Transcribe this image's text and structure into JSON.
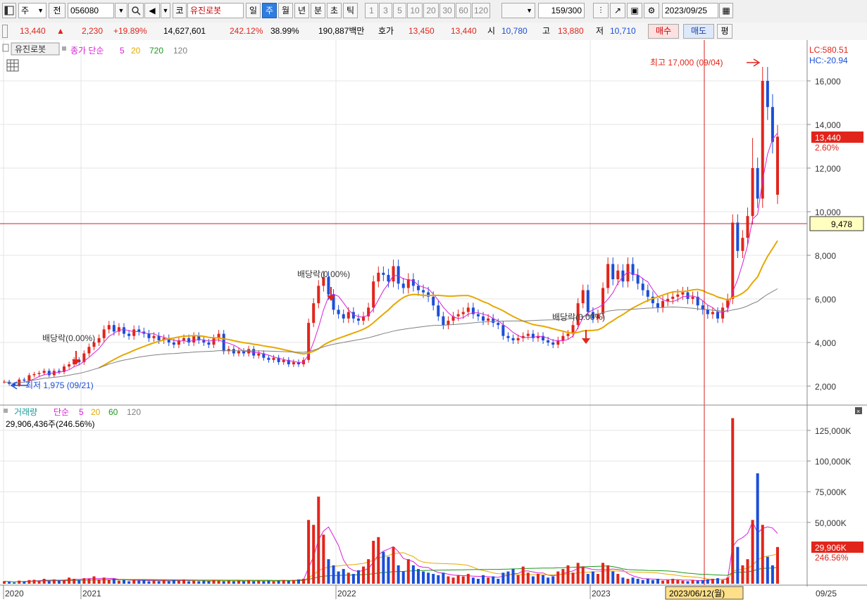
{
  "toolbar": {
    "menu_icon": "window-icon",
    "type_label": "주",
    "jeon_label": "전",
    "code": "056080",
    "market_label": "코",
    "stock_name": "유진로봇",
    "periods": [
      "일",
      "주",
      "월",
      "년",
      "분",
      "초",
      "틱"
    ],
    "active_period": "주",
    "intervals": [
      "1",
      "3",
      "5",
      "10",
      "20",
      "30",
      "60",
      "120"
    ],
    "count": "159",
    "count_total": "/300",
    "date": "2023/09/25"
  },
  "quote": {
    "price": "13,440",
    "change": "2,230",
    "change_pct": "+19.89%",
    "volume": "14,627,601",
    "vol_ratio": "242.12%",
    "turnover": "38.99%",
    "amount": "190,887백만",
    "hoga_label": "호가",
    "ask": "13,450",
    "bid": "13,440",
    "open_label": "시",
    "open": "10,780",
    "high_label": "고",
    "high": "13,880",
    "low_label": "저",
    "low": "10,710",
    "buy_label": "매수",
    "sell_label": "매도",
    "pyeong_label": "평"
  },
  "price_panel": {
    "name_tag": "유진로봇",
    "indicator": "종가 단순",
    "ma_periods": [
      "5",
      "20",
      "720",
      "120"
    ],
    "lc": "LC:580.51",
    "hc": "HC:-20.94",
    "current_price": "13,440",
    "current_pct": "2.60%",
    "crosshair_price": "9,478",
    "high_annotation": "최고 17,000 (09/04)",
    "low_annotation": "최저 1,975 (09/21)",
    "dividend_label": "배당락(0.00%)",
    "y_ticks": [
      "16,000",
      "14,000",
      "12,000",
      "10,000",
      "8,000",
      "6,000",
      "4,000",
      "2,000"
    ]
  },
  "volume_panel": {
    "title": "거래량",
    "indicator": "단순",
    "ma_periods": [
      "5",
      "20",
      "60",
      "120"
    ],
    "current": "29,906,436주(246.56%)",
    "current_tag": "29,906K",
    "current_pct": "246.56%",
    "y_ticks": [
      "125,000K",
      "100,000K",
      "75,000K",
      "50,000K"
    ]
  },
  "x_axis": {
    "labels": [
      "2020",
      "2021",
      "2022",
      "2023"
    ],
    "crosshair_date": "2023/06/12(월)",
    "right_label": "09/25"
  },
  "colors": {
    "up": "#e1251b",
    "down": "#1b4ed8",
    "ma5": "#d81fd8",
    "ma20": "#e6a800",
    "ma60": "#1a9a1a",
    "ma120": "#808080",
    "crosshair": "#d32020"
  },
  "chart_data": {
    "type": "candlestick",
    "timeframe": "weekly",
    "price_range": [
      1300,
      18000
    ],
    "volume_range": [
      0,
      140000
    ],
    "anchors": [
      {
        "date": "2020-09-21",
        "low": 1975
      },
      {
        "date": "2023-09-04",
        "high": 17000
      },
      {
        "date": "2023-09-25",
        "open": 10780,
        "high": 13880,
        "low": 10710,
        "close": 13440,
        "volume_k": 29906
      }
    ],
    "close": [
      2200,
      2100,
      2050,
      2300,
      2250,
      2500,
      2550,
      2600,
      2700,
      2500,
      2700,
      2650,
      2900,
      3000,
      3200,
      3100,
      3500,
      3800,
      4000,
      4200,
      4600,
      4800,
      4500,
      4700,
      4400,
      4300,
      4600,
      4500,
      4400,
      4200,
      4300,
      4100,
      4200,
      4000,
      3900,
      4100,
      4200,
      4000,
      4300,
      4100,
      4000,
      3900,
      4200,
      4400,
      3600,
      3700,
      3500,
      3600,
      3500,
      3700,
      3400,
      3500,
      3300,
      3200,
      3300,
      3100,
      3200,
      3000,
      3100,
      3000,
      3200,
      4900,
      5800,
      6600,
      7000,
      6200,
      5500,
      5300,
      5100,
      5400,
      5100,
      5000,
      5200,
      5600,
      6800,
      7200,
      7100,
      6800,
      7500,
      6700,
      6500,
      6900,
      6600,
      6400,
      6300,
      6100,
      5700,
      5200,
      4800,
      5000,
      5200,
      5300,
      5400,
      5600,
      5300,
      5200,
      5000,
      5100,
      4900,
      4800,
      4300,
      4200,
      4100,
      4200,
      4300,
      4400,
      4200,
      4300,
      4100,
      4000,
      3900,
      4100,
      4300,
      4400,
      4800,
      5800,
      6400,
      5400,
      5100,
      5300,
      6500,
      7600,
      6900,
      7300,
      6800,
      7600,
      7100,
      6700,
      6400,
      6100,
      5800,
      5600,
      5900,
      6000,
      6100,
      6200,
      6300,
      6000,
      6100,
      5700,
      5500,
      5300,
      5400,
      5100,
      5600,
      6000,
      9500,
      8200,
      8800,
      9800,
      12000,
      10600,
      16000,
      14800,
      13200,
      13440
    ],
    "volume_k": [
      2000,
      1500,
      1000,
      2500,
      1800,
      3000,
      3200,
      2200,
      4000,
      2000,
      3500,
      2600,
      3000,
      5000,
      4000,
      3000,
      4500,
      4000,
      6000,
      3500,
      5000,
      3000,
      4000,
      2500,
      3000,
      2000,
      3500,
      2500,
      3000,
      2000,
      2500,
      2000,
      3000,
      2000,
      3000,
      2500,
      3500,
      2000,
      2500,
      2000,
      2500,
      2000,
      3000,
      2500,
      2000,
      2500,
      2000,
      2500,
      2000,
      3000,
      2000,
      2500,
      2000,
      2500,
      2000,
      2500,
      3000,
      2500,
      3000,
      3500,
      4000,
      52000,
      48000,
      71000,
      40000,
      20000,
      15000,
      10000,
      12000,
      9000,
      8000,
      11000,
      14000,
      20000,
      35000,
      38000,
      26000,
      22000,
      30000,
      15000,
      10000,
      20000,
      15000,
      12000,
      10000,
      9000,
      8000,
      7000,
      9000,
      6000,
      5000,
      7000,
      6000,
      8000,
      5000,
      4000,
      7000,
      5000,
      6000,
      4000,
      9000,
      10000,
      12000,
      7000,
      14000,
      9000,
      6000,
      8000,
      7000,
      5000,
      6000,
      10000,
      12000,
      15000,
      9000,
      17000,
      14000,
      8000,
      10000,
      8000,
      17000,
      15000,
      10000,
      8000,
      5000,
      4000,
      5000,
      4000,
      3000,
      4000,
      3000,
      4000,
      2500,
      3000,
      4000,
      3000,
      2500,
      2000,
      3000,
      2500,
      3000,
      3500,
      4000,
      4500,
      3000,
      5000,
      135000,
      30000,
      15000,
      20000,
      52000,
      90000,
      48000,
      22000,
      15000,
      29906
    ]
  }
}
